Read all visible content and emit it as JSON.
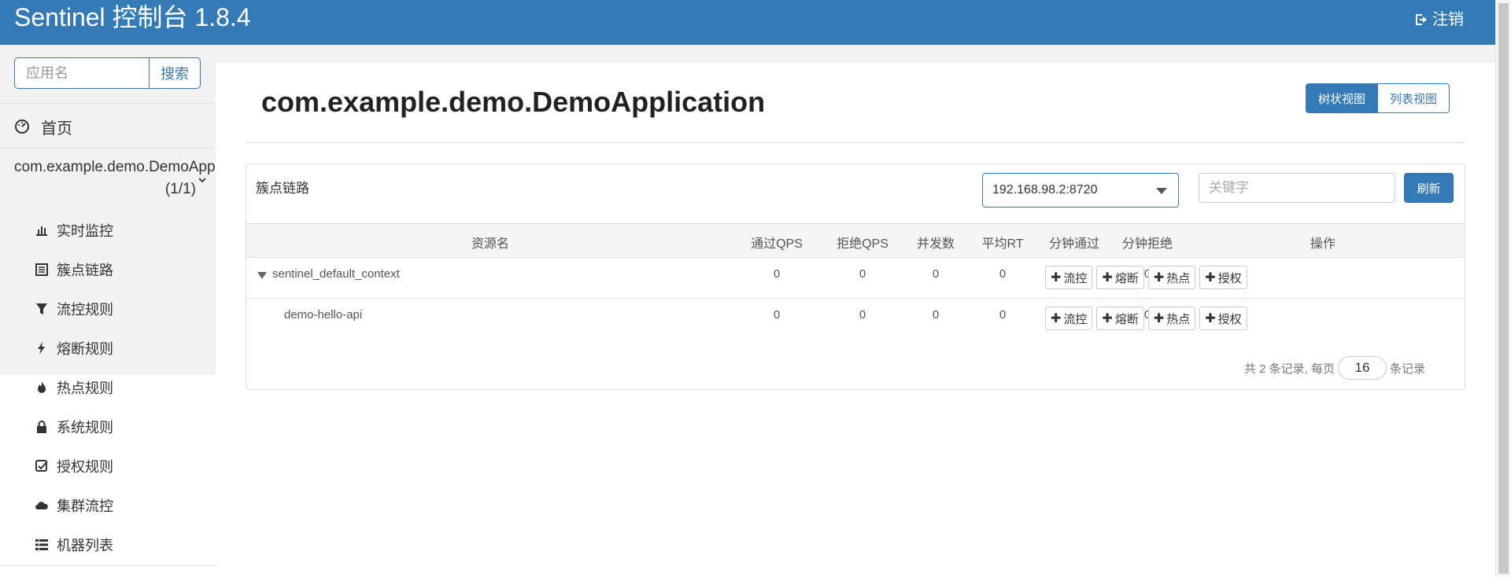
{
  "header": {
    "title": "Sentinel 控制台 1.8.4",
    "logout_label": "注销"
  },
  "sidebar": {
    "search_placeholder": "应用名",
    "search_button": "搜索",
    "home_label": "首页",
    "app_name": "com.example.demo.DemoApplication",
    "app_count": "(1/1)",
    "items": [
      {
        "label": "实时监控",
        "icon": "bar-chart-icon"
      },
      {
        "label": "簇点链路",
        "icon": "list-alt-icon"
      },
      {
        "label": "流控规则",
        "icon": "filter-icon"
      },
      {
        "label": "熔断规则",
        "icon": "flash-icon"
      },
      {
        "label": "热点规则",
        "icon": "fire-icon"
      },
      {
        "label": "系统规则",
        "icon": "lock-icon"
      },
      {
        "label": "授权规则",
        "icon": "check-icon"
      },
      {
        "label": "集群流控",
        "icon": "cloud-icon"
      },
      {
        "label": "机器列表",
        "icon": "th-list-icon"
      }
    ]
  },
  "main": {
    "title": "com.example.demo.DemoApplication",
    "view_tree": "树状视图",
    "view_list": "列表视图",
    "panel_title": "簇点链路",
    "machine": "192.168.98.2:8720",
    "keyword_placeholder": "关键字",
    "refresh_label": "刷新",
    "columns": [
      "资源名",
      "通过QPS",
      "拒绝QPS",
      "并发数",
      "平均RT",
      "分钟通过",
      "分钟拒绝",
      "操作"
    ],
    "rows": [
      {
        "name": "sentinel_default_context",
        "pass_qps": "0",
        "block_qps": "0",
        "concurrency": "0",
        "avg_rt": "0",
        "minute_pass": "0",
        "minute_block": "0"
      },
      {
        "name": "demo-hello-api",
        "pass_qps": "0",
        "block_qps": "0",
        "concurrency": "0",
        "avg_rt": "0",
        "minute_pass": "0",
        "minute_block": "0"
      }
    ],
    "actions": [
      "流控",
      "熔断",
      "热点",
      "授权"
    ],
    "pager": {
      "prefix": "共 2 条记录, 每页",
      "page_size": "16",
      "suffix": "条记录"
    }
  },
  "colors": {
    "primary": "#337ab7",
    "sidebar_bg": "#f2f2f2",
    "content_bg": "#ffffff"
  }
}
